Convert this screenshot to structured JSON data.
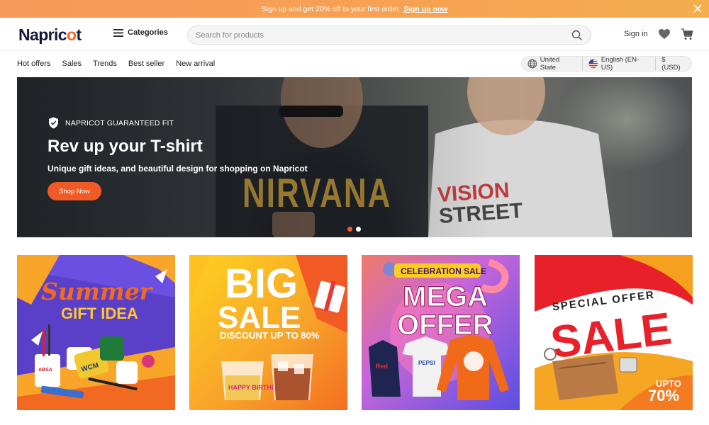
{
  "promo_bar": {
    "message": "Sign up and get 20% off to your first order.",
    "link": "Sign up now"
  },
  "header": {
    "logo_text": "Napric",
    "logo_mark": "o",
    "logo_tail": "t",
    "categories_label": "Categories",
    "search_placeholder": "Search for products",
    "signin_label": "Sign in",
    "icons": [
      "menu-icon",
      "search-icon",
      "heart-icon",
      "cart-icon",
      "close-icon"
    ]
  },
  "nav": {
    "links": [
      "Hot offers",
      "Sales",
      "Trends",
      "Best seller",
      "New arrival"
    ],
    "locale": {
      "country": "United State",
      "language": "English (EN-US)",
      "currency": "$ (USD)"
    }
  },
  "hero": {
    "badge": "NAPRICOT GUARANTEED FIT",
    "title": "Rev up your T-shirt",
    "subtitle": "Unique gift ideas, and beautiful design for shopping on Napricot",
    "button": "Shop Now",
    "tee_left": "NIRVANA",
    "tee_right_line1": "VISION",
    "tee_right_line2": "STREET",
    "carousel_active_index": 1,
    "carousel_count": 2
  },
  "tiles": {
    "summer": {
      "line1": "Summer",
      "line2": "GIFT IDEA",
      "mug_text": "WCM",
      "product_text": "ABSA"
    },
    "big_sale": {
      "line1": "BIG",
      "line2": "SALE",
      "line3": "DISCOUNT UP TO 80%",
      "glass_text": "HAPPY BIRTHDAY"
    },
    "mega": {
      "banner": "CELEBRATION SALE",
      "line1": "MEGA",
      "line2": "OFFER",
      "shirt1": "Red",
      "shirt2": "PEPSI"
    },
    "special": {
      "line1": "SPECIAL OFFER",
      "line2": "SALE",
      "upto": "UPTO",
      "pct": "70%"
    }
  },
  "colors": {
    "accent": "#ef5a26",
    "promo_bar": "#f6a253",
    "logo_dark": "#17173a"
  }
}
